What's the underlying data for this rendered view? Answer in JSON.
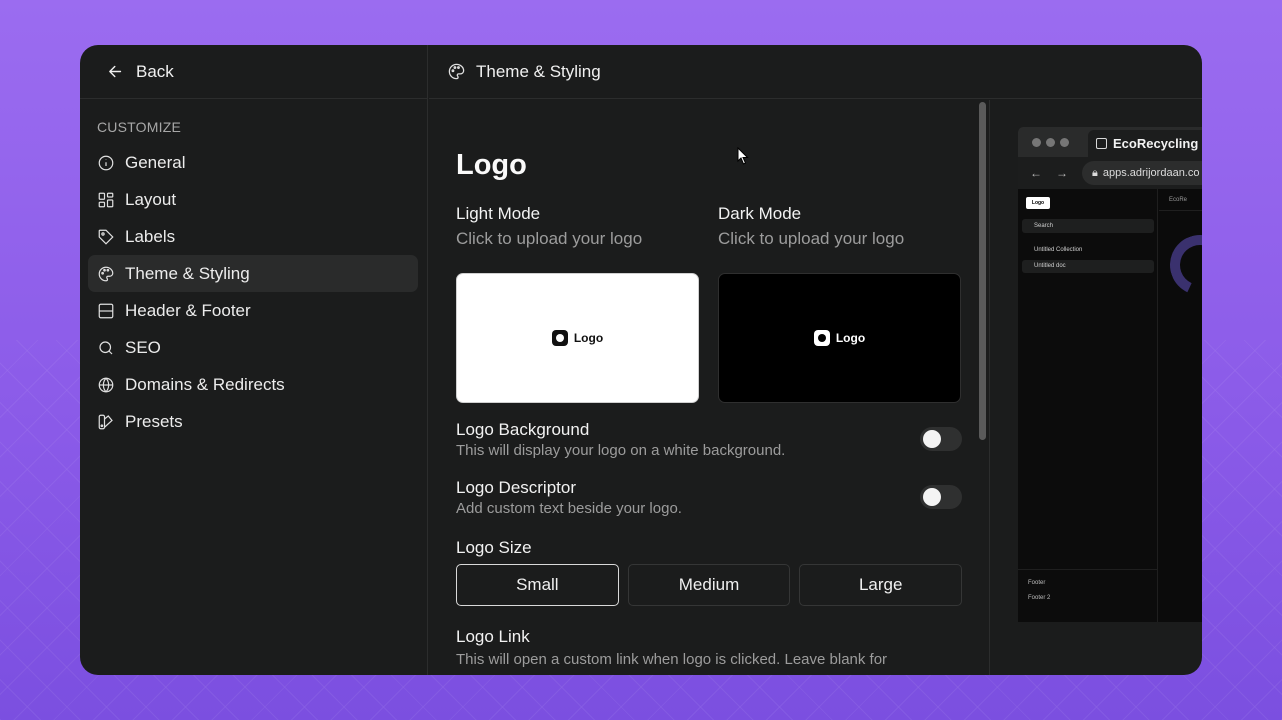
{
  "back": {
    "label": "Back"
  },
  "sidebar": {
    "section_label": "CUSTOMIZE",
    "items": [
      {
        "label": "General",
        "icon": "info-icon"
      },
      {
        "label": "Layout",
        "icon": "layout-grid-icon"
      },
      {
        "label": "Labels",
        "icon": "tag-icon"
      },
      {
        "label": "Theme & Styling",
        "icon": "palette-icon",
        "active": true
      },
      {
        "label": "Header & Footer",
        "icon": "panels-icon"
      },
      {
        "label": "SEO",
        "icon": "search-icon"
      },
      {
        "label": "Domains & Redirects",
        "icon": "globe-icon"
      },
      {
        "label": "Presets",
        "icon": "swatch-icon"
      }
    ]
  },
  "header": {
    "title": "Theme & Styling",
    "icon": "palette-icon"
  },
  "logo_section": {
    "title": "Logo",
    "light_mode": {
      "title": "Light Mode",
      "subtitle": "Click to upload your logo",
      "preview_text": "Logo"
    },
    "dark_mode": {
      "title": "Dark Mode",
      "subtitle": "Click to upload your logo",
      "preview_text": "Logo"
    },
    "logo_background": {
      "title": "Logo Background",
      "description": "This will display your logo on a white background.",
      "enabled": false
    },
    "logo_descriptor": {
      "title": "Logo Descriptor",
      "description": "Add custom text beside your logo.",
      "enabled": false
    },
    "logo_size": {
      "title": "Logo Size",
      "options": [
        "Small",
        "Medium",
        "Large"
      ],
      "selected": "Small"
    },
    "logo_link": {
      "title": "Logo Link",
      "description": "This will open a custom link when logo is clicked. Leave blank for"
    }
  },
  "preview": {
    "tab_title": "EcoRecycling",
    "address": "apps.adrijordaan.co",
    "mini_logo": "Logo",
    "search": "Search",
    "collection": "Untitled Collection",
    "doc": "Untitled doc",
    "breadcrumb": "EcoRe",
    "footer_items": [
      "Footer",
      "Footer 2"
    ]
  },
  "colors": {
    "background": "#8a5ae8",
    "window": "#1b1c1c",
    "active_item": "#2a2b2b"
  }
}
